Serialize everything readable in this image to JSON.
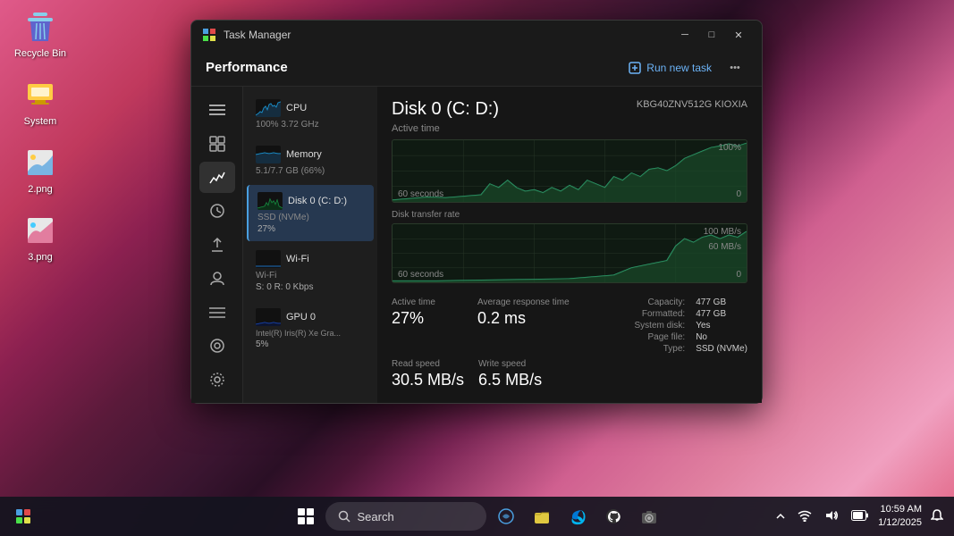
{
  "desktop": {
    "icons": [
      {
        "id": "recycle-bin",
        "label": "Recycle Bin"
      },
      {
        "id": "system",
        "label": "System"
      },
      {
        "id": "2png",
        "label": "2.png"
      },
      {
        "id": "3png",
        "label": "3.png"
      }
    ]
  },
  "taskmanager": {
    "title": "Task Manager",
    "menu_title": "Performance",
    "run_new_task": "Run new task",
    "sidebar_icons": [
      {
        "id": "hamburger",
        "symbol": "☰",
        "active": false
      },
      {
        "id": "processes",
        "symbol": "⊞",
        "active": false
      },
      {
        "id": "performance",
        "symbol": "📊",
        "active": true
      },
      {
        "id": "app-history",
        "symbol": "🕐",
        "active": false
      },
      {
        "id": "startup",
        "symbol": "🚀",
        "active": false
      },
      {
        "id": "users",
        "symbol": "👤",
        "active": false
      },
      {
        "id": "details",
        "symbol": "≡",
        "active": false
      },
      {
        "id": "services",
        "symbol": "↺",
        "active": false
      }
    ],
    "devices": [
      {
        "id": "cpu",
        "name": "CPU",
        "sub": "100% 3.72 GHz",
        "color": "#1a6b9e"
      },
      {
        "id": "memory",
        "name": "Memory",
        "sub": "5.1/7.7 GB (66%)",
        "color": "#1a6b9e"
      },
      {
        "id": "disk0",
        "name": "Disk 0 (C: D:)",
        "sub": "SSD (NVMe)",
        "value": "27%",
        "color": "#1a7a4a",
        "active": true
      },
      {
        "id": "wifi",
        "name": "Wi-Fi",
        "sub": "Wi-Fi",
        "value": "S: 0 R: 0 Kbps",
        "color": "#1a5a9e"
      },
      {
        "id": "gpu0",
        "name": "GPU 0",
        "sub": "Intel(R) Iris(R) Xe Gra...",
        "value": "5%",
        "color": "#1a4a8e"
      }
    ],
    "detail": {
      "title": "Disk 0 (C: D:)",
      "model": "KBG40ZNV512G KIOXIA",
      "active_time_label": "Active time",
      "active_pct_top": "100%",
      "zero_top": "0",
      "sixty_seconds_1": "60 seconds",
      "transfer_rate_label": "Disk transfer rate",
      "rate_100": "100 MB/s",
      "rate_60": "60 MB/s",
      "zero_bottom": "0",
      "sixty_seconds_2": "60 seconds",
      "stats": {
        "active_time_label": "Active time",
        "active_time_value": "27%",
        "avg_response_label": "Average response time",
        "avg_response_value": "0.2 ms",
        "read_speed_label": "Read speed",
        "read_speed_value": "30.5 MB/s",
        "write_speed_label": "Write speed",
        "write_speed_value": "6.5 MB/s"
      },
      "info": {
        "capacity_label": "Capacity:",
        "capacity_value": "477 GB",
        "formatted_label": "Formatted:",
        "formatted_value": "477 GB",
        "system_disk_label": "System disk:",
        "system_disk_value": "Yes",
        "page_file_label": "Page file:",
        "page_file_value": "No",
        "type_label": "Type:",
        "type_value": "SSD (NVMe)"
      }
    }
  },
  "taskbar": {
    "search_placeholder": "Search",
    "time": "10:59 AM",
    "date": "1/12/2025"
  }
}
